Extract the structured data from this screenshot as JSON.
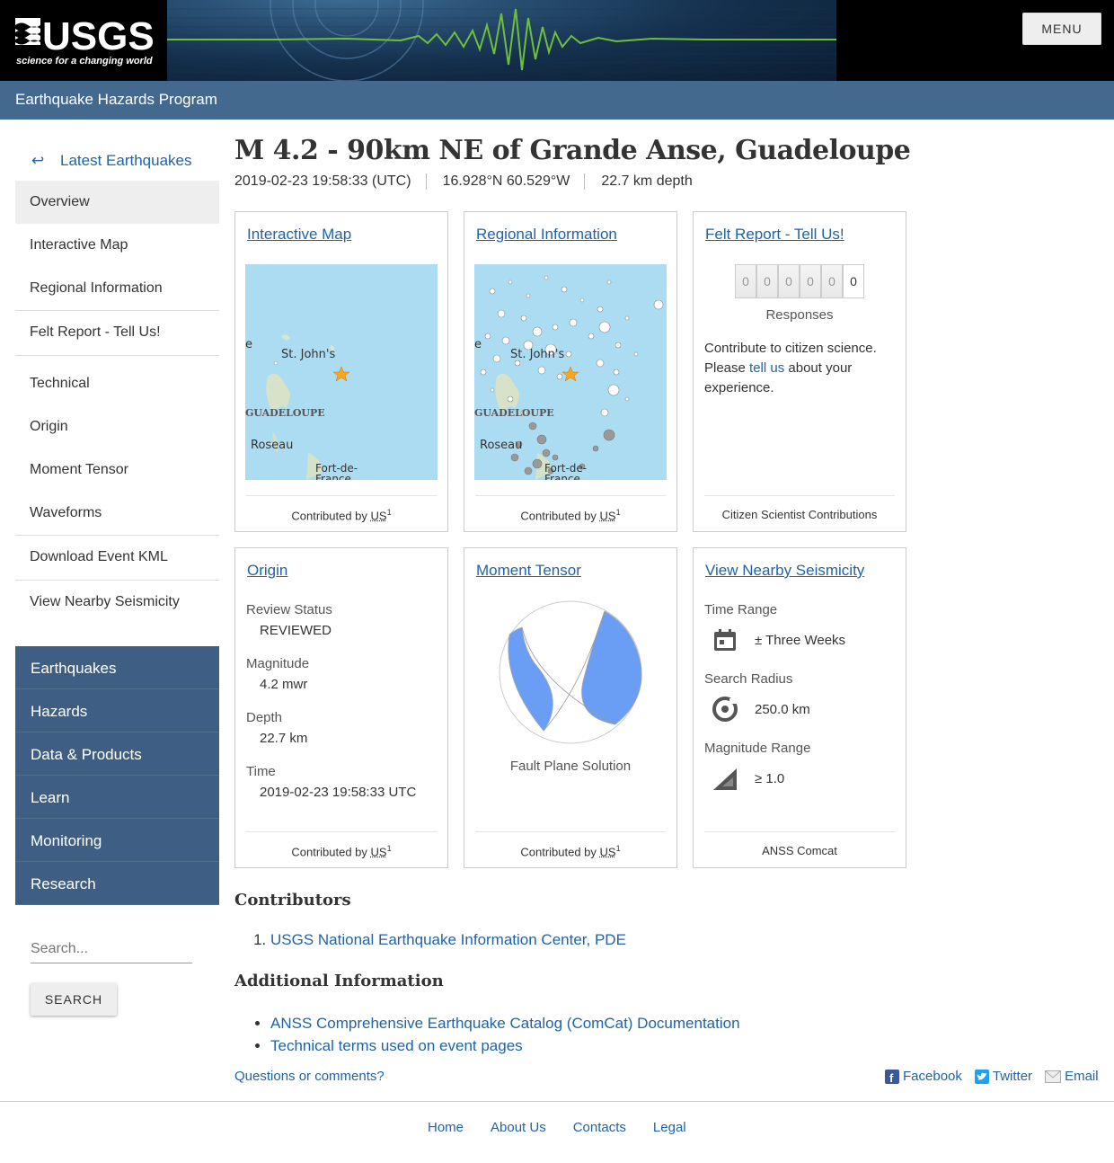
{
  "header": {
    "logo_text": "USGS",
    "logo_tagline": "science for a changing world",
    "menu_label": "MENU",
    "program": "Earthquake Hazards Program"
  },
  "sidebar": {
    "back_link": "Latest Earthquakes",
    "nav": [
      [
        "Overview",
        "Interactive Map",
        "Regional Information"
      ],
      [
        "Felt Report - Tell Us!"
      ],
      [
        "Technical",
        "Origin",
        "Moment Tensor",
        "Waveforms"
      ],
      [
        "Download Event KML"
      ],
      [
        "View Nearby Seismicity"
      ]
    ],
    "sections": [
      "Earthquakes",
      "Hazards",
      "Data & Products",
      "Learn",
      "Monitoring",
      "Research"
    ],
    "search_placeholder": "Search...",
    "search_button": "SEARCH"
  },
  "event": {
    "title": "M 4.2 - 90km NE of Grande Anse, Guadeloupe",
    "time": "2019-02-23 19:58:33 (UTC)",
    "location": "16.928°N 60.529°W",
    "depth": "22.7 km depth"
  },
  "cards": {
    "map": {
      "title": "Interactive Map",
      "labels": {
        "st_johns": "St. John's",
        "guadeloupe": "GUADELOUPE",
        "roseau": "Roseau",
        "fort": "Fort-de-",
        "france": "France",
        "edge_e": "e"
      },
      "contributor_prefix": "Contributed by",
      "contributor": "US",
      "contributor_sup": "1"
    },
    "regional": {
      "title": "Regional Information",
      "labels": {
        "st_johns": "St. John's",
        "guadeloupe": "GUADELOUPE",
        "roseau": "Roseau",
        "fort": "Fort-de-",
        "france": "France",
        "edge_e": "e"
      },
      "contributor_prefix": "Contributed by",
      "contributor": "US",
      "contributor_sup": "1"
    },
    "felt": {
      "title": "Felt Report - Tell Us!",
      "digits": [
        "0",
        "0",
        "0",
        "0",
        "0",
        "0"
      ],
      "responses_label": "Responses",
      "desc_prefix": "Contribute to citizen science. Please",
      "desc_link": "tell us",
      "desc_suffix": "about your experience.",
      "footer": "Citizen Scientist Contributions"
    },
    "origin": {
      "title": "Origin",
      "fields": [
        {
          "label": "Review Status",
          "value": "REVIEWED"
        },
        {
          "label": "Magnitude",
          "value": "4.2 mwr"
        },
        {
          "label": "Depth",
          "value": "22.7 km"
        },
        {
          "label": "Time",
          "value": "2019-02-23 19:58:33 UTC"
        }
      ],
      "contributor_prefix": "Contributed by",
      "contributor": "US",
      "contributor_sup": "1"
    },
    "moment": {
      "title": "Moment Tensor",
      "caption": "Fault Plane Solution",
      "contributor_prefix": "Contributed by",
      "contributor": "US",
      "contributor_sup": "1",
      "fill_color": "#6a9ef5"
    },
    "nearby": {
      "title": "View Nearby Seismicity",
      "time_label": "Time Range",
      "time_value": "± Three Weeks",
      "radius_label": "Search Radius",
      "radius_value": "250.0 km",
      "mag_label": "Magnitude Range",
      "mag_value": "≥ 1.0",
      "footer": "ANSS Comcat"
    }
  },
  "contributors": {
    "heading": "Contributors",
    "items": [
      "USGS National Earthquake Information Center, PDE"
    ]
  },
  "additional": {
    "heading": "Additional Information",
    "items": [
      "ANSS Comprehensive Earthquake Catalog (ComCat) Documentation",
      "Technical terms used on event pages"
    ]
  },
  "questions_link": "Questions or comments?",
  "social": [
    "Facebook",
    "Twitter",
    "Email"
  ],
  "footer_links": [
    "Home",
    "About Us",
    "Contacts",
    "Legal"
  ]
}
